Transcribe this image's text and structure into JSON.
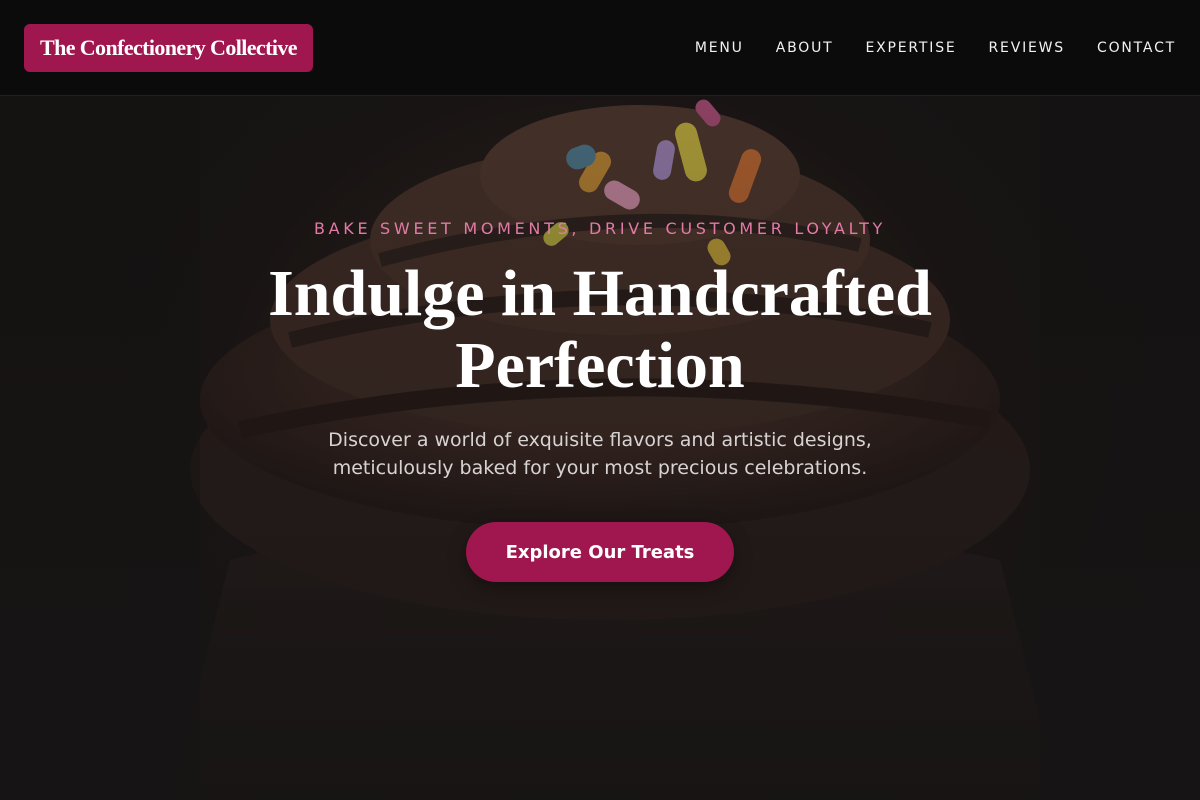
{
  "header": {
    "brand": "The Confectionery Collective",
    "nav": [
      "MENU",
      "ABOUT",
      "EXPERTISE",
      "REVIEWS",
      "CONTACT"
    ]
  },
  "hero": {
    "eyebrow": "BAKE SWEET MOMENTS, DRIVE CUSTOMER LOYALTY",
    "headline": "Indulge in Handcrafted Perfection",
    "subtext": "Discover a world of exquisite flavors and artistic designs, meticulously baked for your most precious celebrations.",
    "cta_label": "Explore Our Treats",
    "background_image": "chocolate-cupcake-with-sprinkles-photo"
  },
  "colors": {
    "accent": "#a0174f",
    "eyebrow": "#e37aa6",
    "header_bg": "#0a0a0a",
    "text": "#ffffff"
  }
}
